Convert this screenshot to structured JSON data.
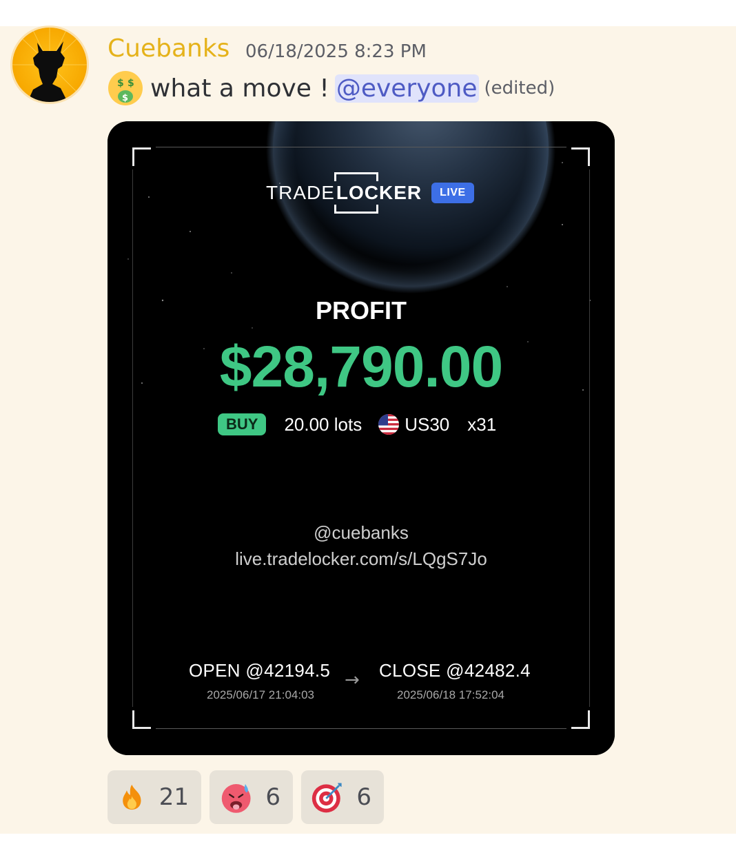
{
  "message": {
    "author": "Cuebanks",
    "timestamp": "06/18/2025 8:23 PM",
    "leading_emoji": "money-mouth-face",
    "text": "what a move !",
    "mention": "@everyone",
    "edited_label": "(edited)"
  },
  "trade_card": {
    "brand_trade": "TRADE",
    "brand_locker": "LOCKER",
    "badge": "LIVE",
    "profit_label": "PROFIT",
    "profit_value": "$28,790.00",
    "side": "BUY",
    "lots": "20.00 lots",
    "symbol": "US30",
    "multiplier": "x31",
    "flag": "us-flag",
    "handle": "@cuebanks",
    "share_url": "live.tradelocker.com/s/LQgS7Jo",
    "open_label": "OPEN @42194.5",
    "open_time": "2025/06/17 21:04:03",
    "close_label": "CLOSE @42482.4",
    "close_time": "2025/06/18 17:52:04",
    "arrow": "→",
    "colors": {
      "profit_green": "#3fc784",
      "live_blue": "#3d6fe6"
    }
  },
  "reactions": [
    {
      "icon": "fire-icon",
      "count": "21"
    },
    {
      "icon": "hot-face-icon",
      "count": "6"
    },
    {
      "icon": "direct-hit-icon",
      "count": "6"
    }
  ],
  "colors": {
    "username": "#e5b21a",
    "mention_text": "#4e5bc4",
    "mention_bg": "#e0e3fb",
    "background": "#fcf5e8"
  }
}
